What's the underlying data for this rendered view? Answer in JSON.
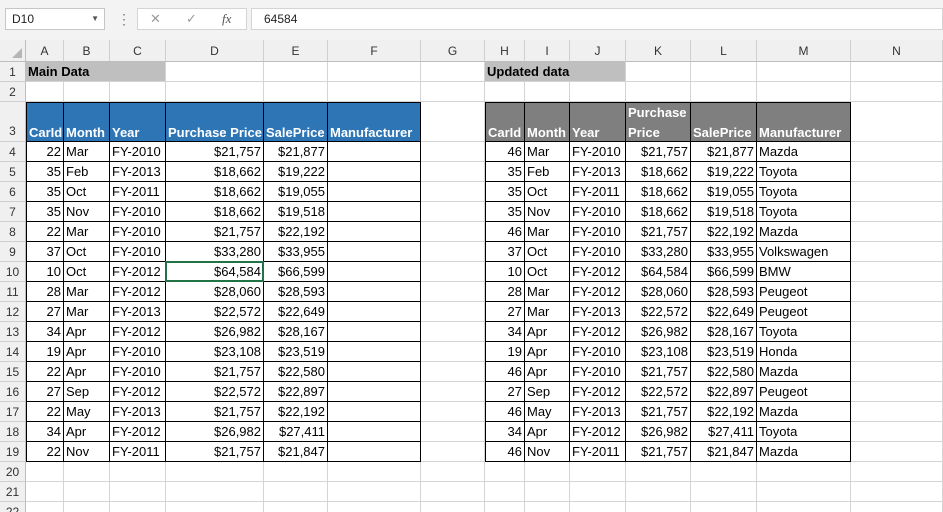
{
  "formula_bar": {
    "name_box": "D10",
    "formula": "64584"
  },
  "columns": [
    "A",
    "B",
    "C",
    "D",
    "E",
    "F",
    "G",
    "H",
    "I",
    "J",
    "K",
    "L",
    "M",
    "N"
  ],
  "rows": [
    "1",
    "2",
    "3",
    "4",
    "5",
    "6",
    "7",
    "8",
    "9",
    "10",
    "11",
    "12",
    "13",
    "14",
    "15",
    "16",
    "17",
    "18",
    "19",
    "20",
    "21",
    "22"
  ],
  "main": {
    "title": "Main Data",
    "headers": [
      "CarId",
      "Month",
      "Year",
      "Purchase Price",
      "SalePrice",
      "Manufacturer"
    ],
    "rows": [
      [
        "22",
        "Mar",
        "FY-2010",
        "$21,757",
        "$21,877",
        ""
      ],
      [
        "35",
        "Feb",
        "FY-2013",
        "$18,662",
        "$19,222",
        ""
      ],
      [
        "35",
        "Oct",
        "FY-2011",
        "$18,662",
        "$19,055",
        ""
      ],
      [
        "35",
        "Nov",
        "FY-2010",
        "$18,662",
        "$19,518",
        ""
      ],
      [
        "22",
        "Mar",
        "FY-2010",
        "$21,757",
        "$22,192",
        ""
      ],
      [
        "37",
        "Oct",
        "FY-2010",
        "$33,280",
        "$33,955",
        ""
      ],
      [
        "10",
        "Oct",
        "FY-2012",
        "$64,584",
        "$66,599",
        ""
      ],
      [
        "28",
        "Mar",
        "FY-2012",
        "$28,060",
        "$28,593",
        ""
      ],
      [
        "27",
        "Mar",
        "FY-2013",
        "$22,572",
        "$22,649",
        ""
      ],
      [
        "34",
        "Apr",
        "FY-2012",
        "$26,982",
        "$28,167",
        ""
      ],
      [
        "19",
        "Apr",
        "FY-2010",
        "$23,108",
        "$23,519",
        ""
      ],
      [
        "22",
        "Apr",
        "FY-2010",
        "$21,757",
        "$22,580",
        ""
      ],
      [
        "27",
        "Sep",
        "FY-2012",
        "$22,572",
        "$22,897",
        ""
      ],
      [
        "22",
        "May",
        "FY-2013",
        "$21,757",
        "$22,192",
        ""
      ],
      [
        "34",
        "Apr",
        "FY-2012",
        "$26,982",
        "$27,411",
        ""
      ],
      [
        "22",
        "Nov",
        "FY-2011",
        "$21,757",
        "$21,847",
        ""
      ]
    ]
  },
  "updated": {
    "title": "Updated data",
    "headers": [
      "CarId",
      "Month",
      "Year",
      "Purchase Price",
      "SalePrice",
      "Manufacturer"
    ],
    "rows": [
      [
        "46",
        "Mar",
        "FY-2010",
        "$21,757",
        "$21,877",
        "Mazda"
      ],
      [
        "35",
        "Feb",
        "FY-2013",
        "$18,662",
        "$19,222",
        "Toyota"
      ],
      [
        "35",
        "Oct",
        "FY-2011",
        "$18,662",
        "$19,055",
        "Toyota"
      ],
      [
        "35",
        "Nov",
        "FY-2010",
        "$18,662",
        "$19,518",
        "Toyota"
      ],
      [
        "46",
        "Mar",
        "FY-2010",
        "$21,757",
        "$22,192",
        "Mazda"
      ],
      [
        "37",
        "Oct",
        "FY-2010",
        "$33,280",
        "$33,955",
        "Volkswagen"
      ],
      [
        "10",
        "Oct",
        "FY-2012",
        "$64,584",
        "$66,599",
        "BMW"
      ],
      [
        "28",
        "Mar",
        "FY-2012",
        "$28,060",
        "$28,593",
        "Peugeot"
      ],
      [
        "27",
        "Mar",
        "FY-2013",
        "$22,572",
        "$22,649",
        "Peugeot"
      ],
      [
        "34",
        "Apr",
        "FY-2012",
        "$26,982",
        "$28,167",
        "Toyota"
      ],
      [
        "19",
        "Apr",
        "FY-2010",
        "$23,108",
        "$23,519",
        "Honda"
      ],
      [
        "46",
        "Apr",
        "FY-2010",
        "$21,757",
        "$22,580",
        "Mazda"
      ],
      [
        "27",
        "Sep",
        "FY-2012",
        "$22,572",
        "$22,897",
        "Peugeot"
      ],
      [
        "46",
        "May",
        "FY-2013",
        "$21,757",
        "$22,192",
        "Mazda"
      ],
      [
        "34",
        "Apr",
        "FY-2012",
        "$26,982",
        "$27,411",
        "Toyota"
      ],
      [
        "46",
        "Nov",
        "FY-2011",
        "$21,757",
        "$21,847",
        "Mazda"
      ]
    ]
  },
  "icons": {
    "cancel": "✕",
    "enter": "✓",
    "function": "fx",
    "more": "⋮"
  },
  "colors": {
    "main_header": "#2e75b6",
    "updated_header": "#7f7f7f",
    "title_fill": "#bfbfbf"
  }
}
